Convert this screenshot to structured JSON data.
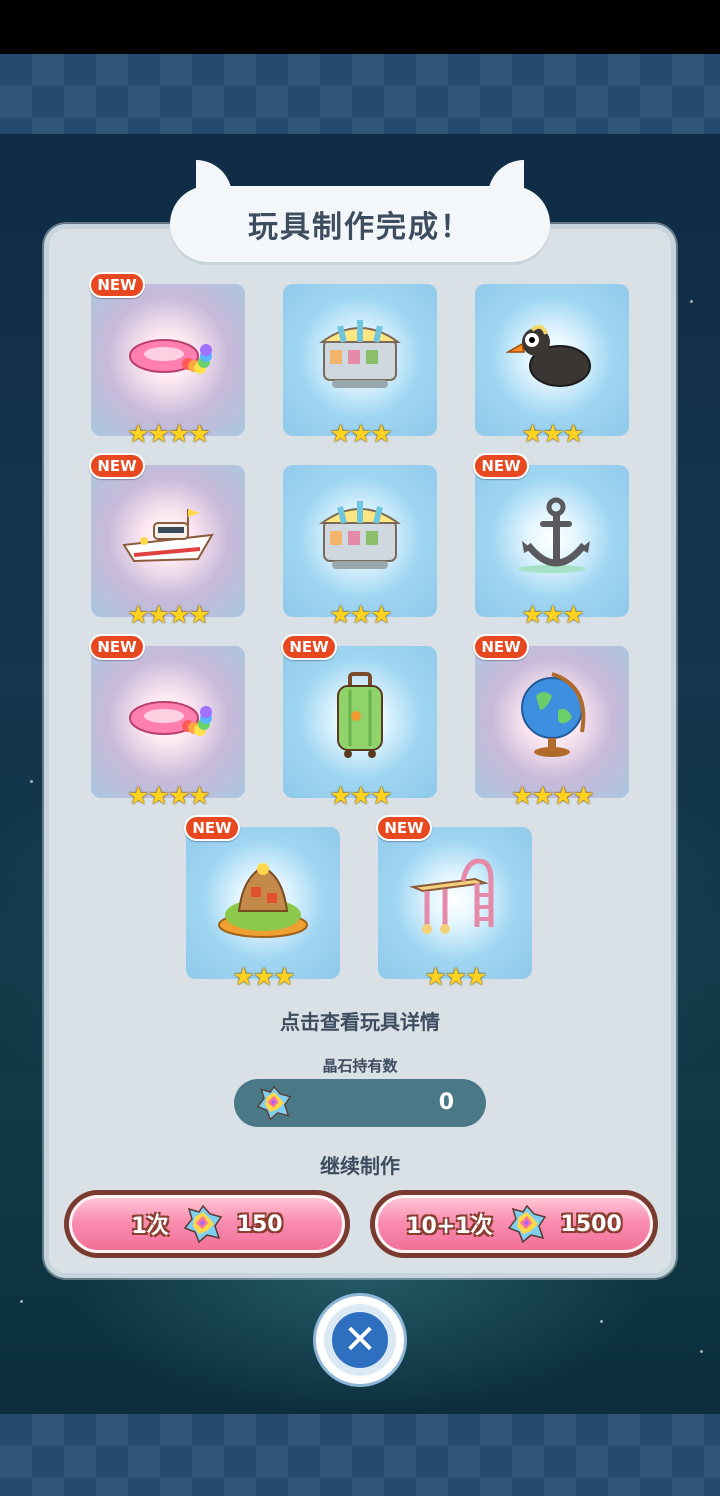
{
  "title": "玩具制作完成！",
  "items": [
    {
      "name": "pink-float",
      "stars": "★★★★",
      "new": "NEW",
      "rarity": "pink"
    },
    {
      "name": "shop-cart",
      "stars": "★★★",
      "new": "",
      "rarity": "blue"
    },
    {
      "name": "black-bird",
      "stars": "★★★",
      "new": "",
      "rarity": "blue"
    },
    {
      "name": "yacht",
      "stars": "★★★★",
      "new": "NEW",
      "rarity": "pink"
    },
    {
      "name": "shop-cart",
      "stars": "★★★",
      "new": "",
      "rarity": "blue"
    },
    {
      "name": "anchor",
      "stars": "★★★",
      "new": "NEW",
      "rarity": "blue"
    },
    {
      "name": "pink-float",
      "stars": "★★★★",
      "new": "NEW",
      "rarity": "pink"
    },
    {
      "name": "suitcase",
      "stars": "★★★",
      "new": "NEW",
      "rarity": "blue"
    },
    {
      "name": "globe",
      "stars": "★★★★",
      "new": "NEW",
      "rarity": "pink"
    },
    {
      "name": "island",
      "stars": "★★★",
      "new": "NEW",
      "rarity": "blue"
    },
    {
      "name": "diving-board",
      "stars": "★★★",
      "new": "NEW",
      "rarity": "blue"
    }
  ],
  "hint": "点击查看玩具详情",
  "crystal": {
    "label": "晶石持有数",
    "count": "0"
  },
  "continue_label": "继续制作",
  "buttons": {
    "single": {
      "label": "1次",
      "cost": "150"
    },
    "multi": {
      "label": "10+1次",
      "cost": "1500"
    }
  },
  "icons": {
    "gem": "rainbow-crystal-icon",
    "close": "close-x-icon"
  }
}
